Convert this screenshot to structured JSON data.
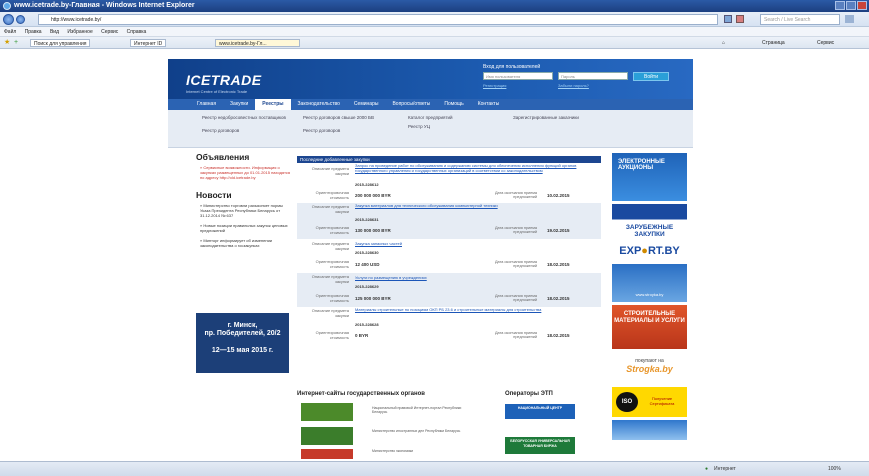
{
  "window": {
    "title": "www.icetrade.by-Главная - Windows Internet Explorer"
  },
  "toolbar": {
    "address": "http://www.icetrade.by/",
    "search_placeholder": "Search / Live Search",
    "menu": [
      "Файл",
      "Правка",
      "Вид",
      "Избранное",
      "Сервис",
      "Справка"
    ],
    "fav_items": [
      "Поиск для управления",
      "Интернет ID",
      "www.icetrade.by-Гл..."
    ],
    "right_tools": [
      "Страница",
      "Сервис"
    ]
  },
  "site": {
    "logo": "ICETRADE",
    "slogan": "Internet Centre of Electronic Trade",
    "login": {
      "title": "Вход для пользователей",
      "login_placeholder": "Имя пользователя",
      "password_placeholder": "Пароль",
      "button": "Войти",
      "register": "Регистрация",
      "forgot": "Забыли пароль?"
    },
    "nav": [
      "Главная",
      "Закупки",
      "Реестры",
      "Законодательство",
      "Семинары",
      "Вопросы/ответы",
      "Помощь",
      "Контакты"
    ],
    "nav_active_index": 2,
    "subnav": [
      "Реестр недобросовестных поставщиков",
      "Реестр договоров",
      "Реестр договоров свыше 2000 БВ",
      "Реестр договоров",
      "Каталог предприятий",
      "Реестр УЦ",
      "Зарегистрированные заказчики"
    ],
    "ann_title": "Объявления",
    "ann_text": "» Сервисные возможности. Информация о закупках размещенных до 01.01.2015 находятся по адресу http://old.icetrade.by",
    "news_title": "Новости",
    "news": [
      "» Министерство торговли разъясняет нормы Указа Президента Республики Беларусь от 31.12.2014 № 637",
      "» Новые позиции правильных закупок ценовых предложений",
      "» Минторг информирует об изменении законодательства о госзакупках"
    ],
    "event": {
      "city": "г. Минск,",
      "address": "пр. Победителей, 20/2",
      "dates": "12—15 мая 2015 г."
    },
    "purch_header": "Последние добавленные закупки",
    "labels": {
      "subject": "Описание предмета закупки",
      "cost": "Ориентировочная стоимость",
      "deadline": "Дата окончания приема предложений"
    },
    "purchases": [
      {
        "title": "Запрос на проведение работ по обслуживанию и содержанию системы для обеспечения исполнения функций органов государственного управления и государственных организаций в соответствии со законодательством",
        "number": "2015-228612",
        "cost": "200 000 000 BYR",
        "date": "10.02.2015"
      },
      {
        "title": "Закупка материалов для технического обслуживания компьютерной техники",
        "number": "2015-228631",
        "cost": "130 000 000 BYR",
        "date": "19.02.2015"
      },
      {
        "title": "Закупка запасных частей",
        "number": "2015-228630",
        "cost": "12 400 USD",
        "date": "18.02.2015"
      },
      {
        "title": "Услуги по размещению в учреждениях",
        "number": "2015-228629",
        "cost": "125 000 000 BYR",
        "date": "18.02.2015"
      },
      {
        "title": "Материалы строительные по позициям ОКП РБ 23.6 и строительные материалы для строительства",
        "number": "2015-228628",
        "cost": "0 BYR",
        "date": "18.02.2015"
      }
    ],
    "banners": [
      "ЭЛЕКТРОННЫЕ АУКЦИОНЫ",
      "ЗАРУБЕЖНЫЕ ЗАКУПКИ",
      "EXP",
      "RT.BY",
      "www.stroyka.by",
      "СТРОИТЕЛЬНЫЕ МАТЕРИАЛЫ И УСЛУГИ",
      "покупают на",
      "Strogka.by",
      "ISO",
      "Получение Сертификата"
    ],
    "sites_title": "Интернет-сайты государственных органов",
    "sites": [
      "Национальный правовой Интернет-портал Республики Беларусь",
      "Министерство иностранных дел Республики Беларусь",
      "Министерство экономики"
    ],
    "operators_title": "Операторы ЭТП",
    "operators": [
      "НАЦИОНАЛЬНЫЙ ЦЕНТР",
      "БЕЛОРУССКАЯ УНИВЕРСАЛЬНАЯ ТОВАРНАЯ БИРЖА"
    ]
  },
  "status": {
    "zone": "Интернет",
    "zoom": "100%"
  },
  "colors": {
    "brand_blue": "#1c4690",
    "nav_blue": "#2b63b3",
    "accent_red": "#c8302a",
    "link_blue": "#1c56b8"
  }
}
